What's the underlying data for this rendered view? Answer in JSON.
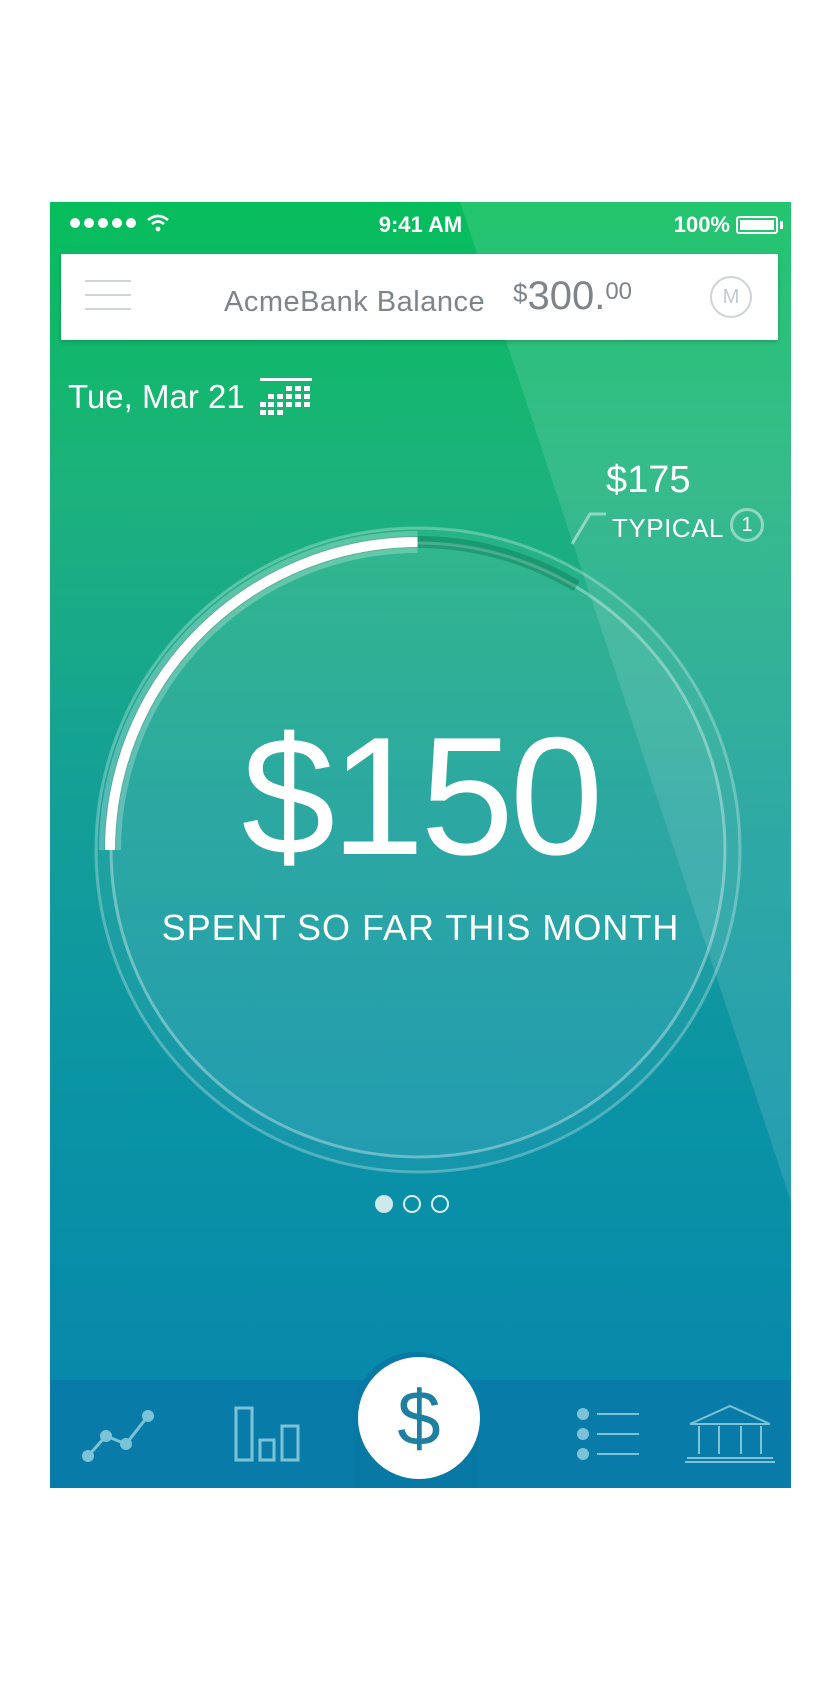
{
  "status_bar": {
    "time": "9:41 AM",
    "battery": "100%"
  },
  "header": {
    "bank_label": "AcmeBank Balance",
    "balance_currency": "$",
    "balance_whole": "300.",
    "balance_cents": "00"
  },
  "date": "Tue, Mar 21",
  "typical": {
    "amount": "$175",
    "label": "TYPICAL",
    "badge": "1"
  },
  "spent": {
    "amount": "$150",
    "caption": "SPENT SO FAR THIS MONTH"
  },
  "progress": {
    "spent_fraction_of_typical": 0.857
  },
  "pager": {
    "count": 3,
    "active_index": 0
  },
  "tabbar": {
    "center_label": "$"
  },
  "colors": {
    "accent": "#1f7fa0",
    "tabbar": "#097ba8",
    "top_green": "#05bd5b"
  }
}
